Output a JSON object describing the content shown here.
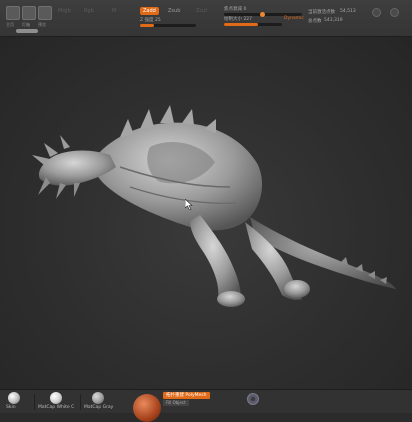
{
  "toolbar": {
    "icons": [
      {
        "name": "home-page-icon",
        "caption": "主页"
      },
      {
        "name": "light-box-icon",
        "caption": "灯箱"
      },
      {
        "name": "preview-icon",
        "caption": "预览"
      },
      {
        "name": "edit-icon",
        "caption": ""
      }
    ],
    "modes": [
      "Mrgb",
      "Rgb",
      "M"
    ],
    "zadd_label": "Zadd",
    "zsub_label": "Zsub",
    "zcut_label": "Zcut",
    "focal_label": "焦点衰减",
    "focal_value": "0",
    "draw_size_label": "绘制大小",
    "draw_size_value": "227",
    "intensity_label": "Z 强度",
    "intensity_value": "25",
    "dynamic_label": "Dynamic",
    "active_points_label": "当前激活点数",
    "active_points_value": "54,513",
    "total_points_label": "总点数",
    "total_points_value": "543,319"
  },
  "materials": [
    {
      "label": "Skin",
      "color": "#d8d8d8"
    },
    {
      "label": "MatCap White C",
      "color": "#e4e4e4"
    },
    {
      "label": "MatCap Gray",
      "color": "#a8a8a8"
    }
  ],
  "polypaint": {
    "badge": "拓扑重建 PolyMesh",
    "sub": "Fill Object"
  },
  "colors": {
    "accent": "#e06a18",
    "background": "#2b2b2b"
  }
}
